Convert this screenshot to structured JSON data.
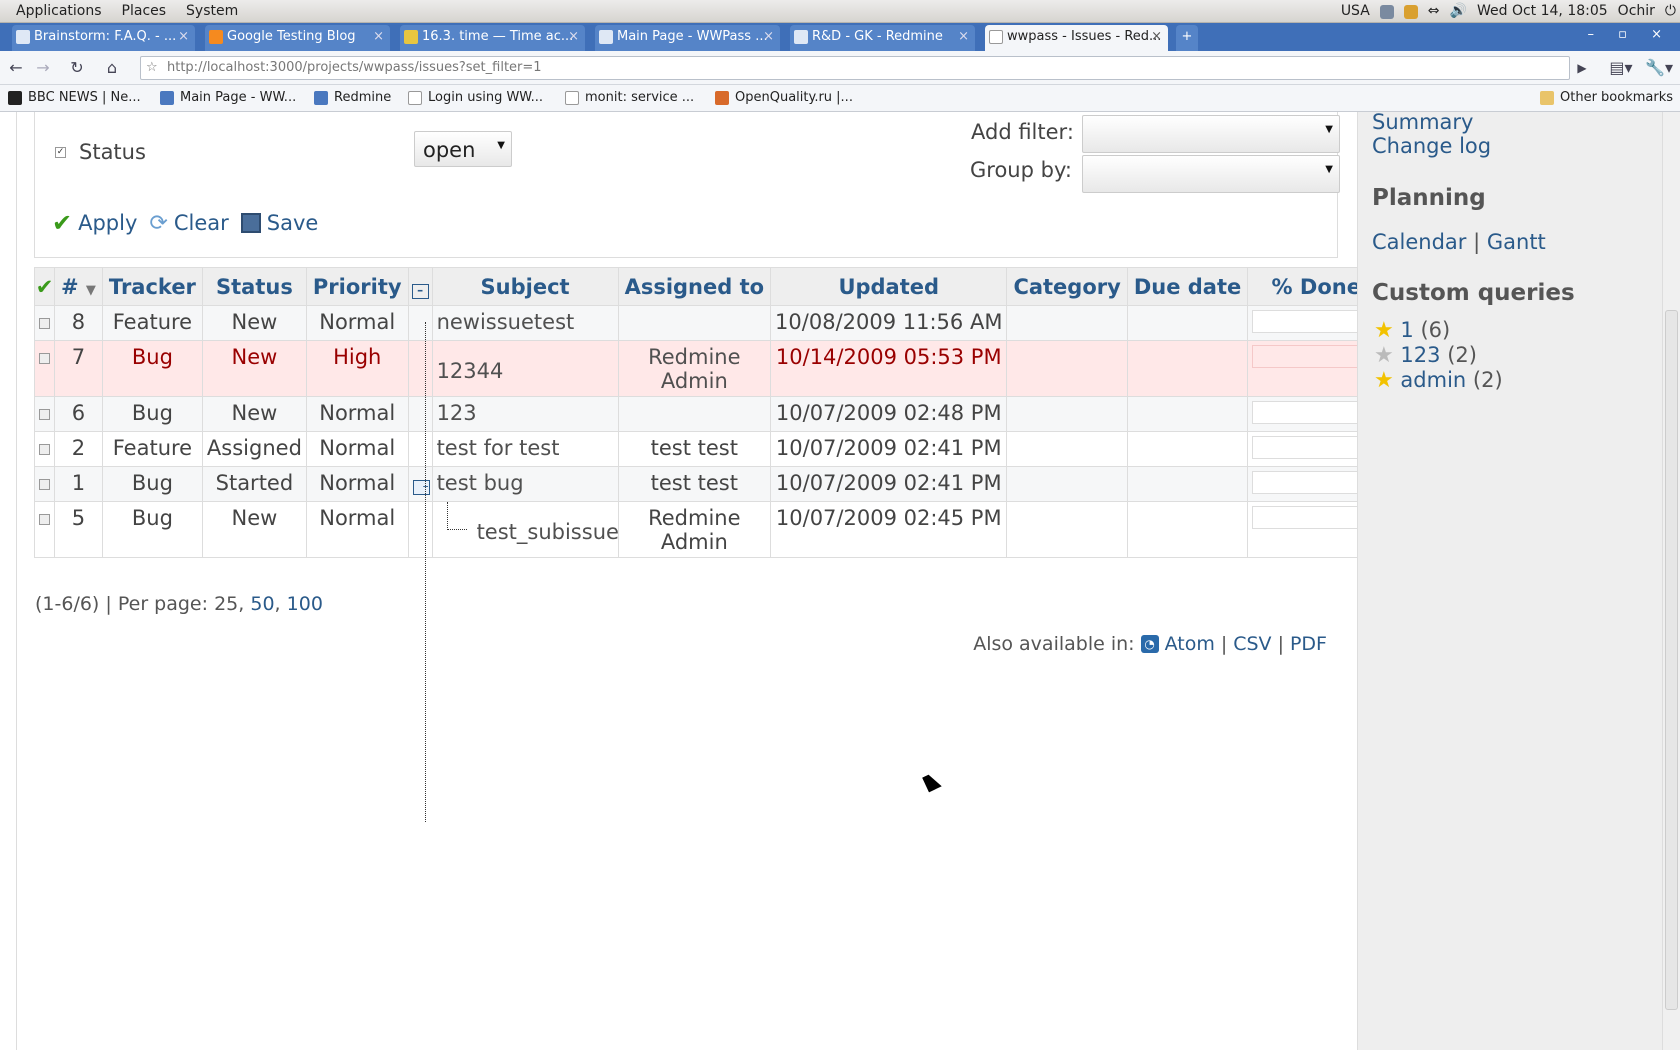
{
  "top_panel": {
    "menus": [
      "Applications",
      "Places",
      "System"
    ],
    "layout": "USA",
    "clock": "Wed Oct 14, 18:05",
    "user": "Ochir"
  },
  "tabs": [
    {
      "label": "Brainstorm: F.A.Q. - ...",
      "active": false
    },
    {
      "label": "Google Testing Blog",
      "active": false
    },
    {
      "label": "16.3. time — Time ac...",
      "active": false
    },
    {
      "label": "Main Page - WWPass ...",
      "active": false
    },
    {
      "label": "R&D - GK - Redmine",
      "active": false
    },
    {
      "label": "wwpass - Issues - Red...",
      "active": true
    }
  ],
  "url": "http://localhost:3000/projects/wwpass/issues?set_filter=1",
  "bookmarks": [
    "BBC NEWS | Ne...",
    "Main Page - WW...",
    "Redmine",
    "Login using WW...",
    "monit: service ...",
    "OpenQuality.ru |...",
    "Other bookmarks"
  ],
  "filters": {
    "status_label": "Status",
    "status_value": "open",
    "add_filter_label": "Add filter:",
    "group_by_label": "Group by:",
    "apply": "Apply",
    "clear": "Clear",
    "save": "Save"
  },
  "table": {
    "columns": [
      "#",
      "Tracker",
      "Status",
      "Priority",
      "Subject",
      "Assigned to",
      "Updated",
      "Category",
      "Due date",
      "% Done"
    ],
    "rows": [
      {
        "id": "8",
        "tracker": "Feature",
        "status": "New",
        "priority": "Normal",
        "subject": "newissuetest",
        "assigned": "",
        "updated": "10/08/2009 11:56 AM",
        "style": "odd"
      },
      {
        "id": "7",
        "tracker": "Bug",
        "status": "New",
        "priority": "High",
        "subject": "12344",
        "assigned": "Redmine Admin",
        "updated": "10/14/2009 05:53 PM",
        "style": "high"
      },
      {
        "id": "6",
        "tracker": "Bug",
        "status": "New",
        "priority": "Normal",
        "subject": "123",
        "assigned": "",
        "updated": "10/07/2009 02:48 PM",
        "style": "odd"
      },
      {
        "id": "2",
        "tracker": "Feature",
        "status": "Assigned",
        "priority": "Normal",
        "subject": "test for test",
        "assigned": "test test",
        "updated": "10/07/2009 02:41 PM",
        "style": "even"
      },
      {
        "id": "1",
        "tracker": "Bug",
        "status": "Started",
        "priority": "Normal",
        "subject": "test bug",
        "assigned": "test test",
        "updated": "10/07/2009 02:41 PM",
        "style": "odd"
      },
      {
        "id": "5",
        "tracker": "Bug",
        "status": "New",
        "priority": "Normal",
        "subject": "test_subissue",
        "assigned": "Redmine Admin",
        "updated": "10/07/2009 02:45 PM",
        "style": "even"
      }
    ]
  },
  "pagination": {
    "range": "(1-6/6)",
    "per_page_label": "| Per page:",
    "current": "25",
    "opt1": "50",
    "opt2": "100"
  },
  "export": {
    "label": "Also available in:",
    "atom": "Atom",
    "csv": "CSV",
    "pdf": "PDF"
  },
  "sidebar": {
    "summary": "Summary",
    "changelog": "Change log",
    "planning_title": "Planning",
    "calendar": "Calendar",
    "gantt": "Gantt",
    "custom_queries_title": "Custom queries",
    "queries": [
      {
        "name": "1",
        "count": "(6)"
      },
      {
        "name": "123",
        "count": "(2)"
      },
      {
        "name": "admin",
        "count": "(2)"
      }
    ]
  }
}
